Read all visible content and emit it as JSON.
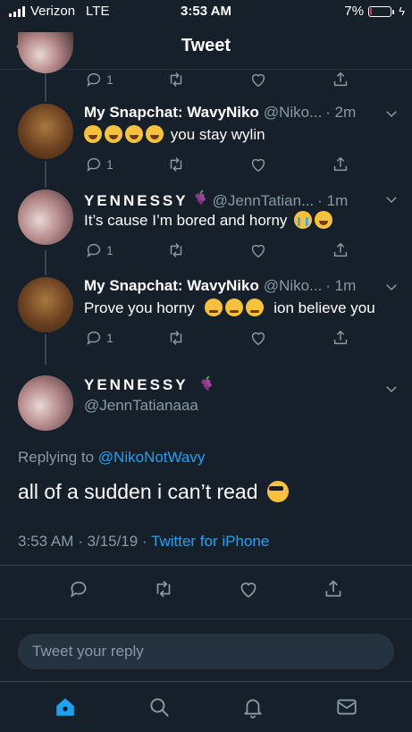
{
  "status_bar": {
    "carrier": "Verizon",
    "network": "LTE",
    "time": "3:53 AM",
    "battery": "7%",
    "battery_level": 0.07,
    "battery_color": "#e0245e"
  },
  "nav": {
    "title": "Tweet",
    "back_icon": "chevron-left-icon"
  },
  "thread": [
    {
      "display_name": "My Snapchat: WavyNiko",
      "handle": "@Niko...",
      "time": "· 2m",
      "text": "you stay wylin",
      "emojis": [
        "laugh",
        "laugh",
        "laugh",
        "laugh"
      ],
      "reply_count": "1"
    },
    {
      "display_name": "YENNESSY",
      "handle": "@JennTatian...",
      "time": "· 1m",
      "text": "It’s cause I’m bored and horny",
      "trailing_emojis": [
        "cry",
        "laugh"
      ],
      "reply_count": "1"
    },
    {
      "display_name": "My Snapchat: WavyNiko",
      "handle": "@Niko...",
      "time": "· 1m",
      "text_before": "Prove you horny",
      "text_after": "ion believe you",
      "emojis": [
        "sleep",
        "sleep",
        "sleep"
      ],
      "reply_count": "1"
    }
  ],
  "top_partial_reply_count": "1",
  "main_tweet": {
    "display_name": "YENNESSY",
    "handle": "@JennTatianaaa",
    "replying_prefix": "Replying to",
    "replying_to": "@NikoNotWavy",
    "text": "all of a sudden i can’t read",
    "timestamp": "3:53 AM · 3/15/19 ·",
    "client": "Twitter for iPhone"
  },
  "reply_bar": {
    "placeholder": "Tweet your reply"
  },
  "tab_bar": {
    "tabs": [
      "home-icon",
      "search-icon",
      "notifications-icon",
      "messages-icon"
    ],
    "active_color": "#1da1f2"
  },
  "colors": {
    "background": "#15202b",
    "secondary_text": "#8899a6",
    "accent": "#1da1f2"
  }
}
